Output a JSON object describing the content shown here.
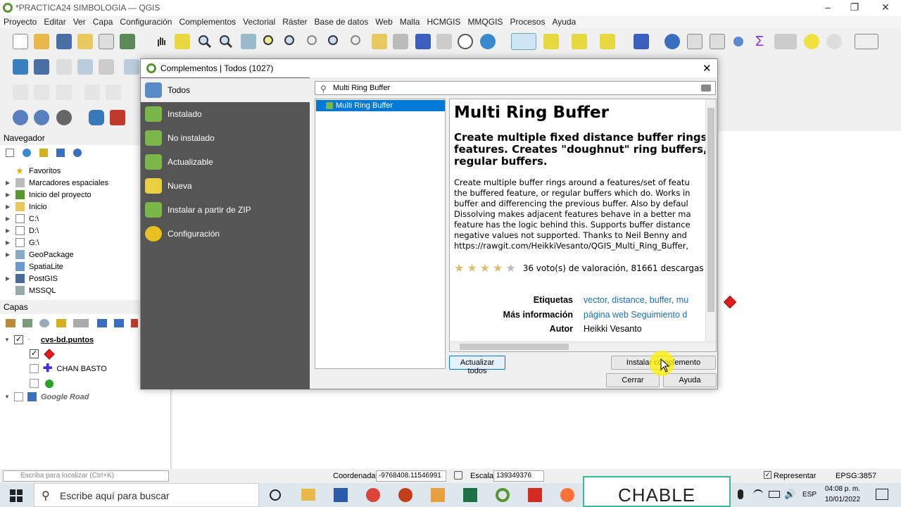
{
  "window": {
    "title": "*PRACTICA24 SIMBOLOGIA — QGIS"
  },
  "menu": [
    "Proyecto",
    "Editar",
    "Ver",
    "Capa",
    "Configuración",
    "Complementos",
    "Vectorial",
    "Ráster",
    "Base de datos",
    "Web",
    "Malla",
    "HCMGIS",
    "MMQGIS",
    "Procesos",
    "Ayuda"
  ],
  "navigator": {
    "title": "Navegador",
    "items": [
      "Favoritos",
      "Marcadores espaciales",
      "Inicio del proyecto",
      "Inicio",
      "C:\\",
      "D:\\",
      "G:\\",
      "GeoPackage",
      "SpatiaLite",
      "PostGIS",
      "MSSQL"
    ]
  },
  "layers": {
    "title": "Capas",
    "layer1": "cvs-bd.puntos",
    "sub2": "CHAN BASTO",
    "layer2": "Google Road"
  },
  "dialog": {
    "title": "Complementos | Todos (1027)",
    "sidebar": [
      "Todos",
      "Instalado",
      "No instalado",
      "Actualizable",
      "Nueva",
      "Instalar a partir de ZIP",
      "Configuración"
    ],
    "search_value": "Multi Ring Buffer",
    "list_selected": "Multi Ring Buffer",
    "detail": {
      "title": "Multi Ring Buffer",
      "subtitle_lines": [
        "Create multiple fixed distance buffer rings a",
        "features. Creates \"doughnut\" ring buffers, r",
        "regular buffers."
      ],
      "body_lines": [
        "Create multiple buffer rings around a features/set of featu",
        "the buffered feature, or regular buffers which do. Works in",
        "buffer and differencing the previous buffer. Also by defaul",
        "Dissolving makes adjacent features behave in a better ma",
        "feature has the logic behind this. Supports buffer distance",
        "negative values not supported. Thanks to Neil Benny and",
        "https://rawgit.com/HeikkiVesanto/QGIS_Multi_Ring_Buffer,"
      ],
      "votes": "36 voto(s) de valoración, 81661 descargas",
      "tags_label": "Etiquetas",
      "tags_value": "vector, distance, buffer, mu",
      "info_label": "Más información",
      "info_value": "página web   Seguimiento d",
      "author_label": "Autor",
      "author_value": "Heikki Vesanto"
    },
    "buttons": {
      "update_all": "Actualizar todos",
      "install": "Instalar complemento",
      "close": "Cerrar",
      "help": "Ayuda"
    }
  },
  "statusbar": {
    "search_placeholder": "Escriba para localizar (Ctrl+K)",
    "coord_label": "Coordenada",
    "coord_value": "-9768408.11546991",
    "scale_label": "Escala",
    "scale_value": "139349376",
    "render_label": "Representar",
    "crs": "EPSG:3857"
  },
  "taskbar": {
    "search_placeholder": "Escribe aquí para buscar",
    "time": "04:08 p. m.",
    "date": "10/01/2022",
    "lang": "ESP",
    "overlay_text": "CHABLE"
  },
  "colors": {
    "qgis_green": "#589632",
    "selection_blue": "#0078d7",
    "sidebar_gray": "#555555",
    "marker_red": "#e01b1b",
    "marker_green": "#27a327",
    "cross_blue": "#4a2bd6"
  }
}
